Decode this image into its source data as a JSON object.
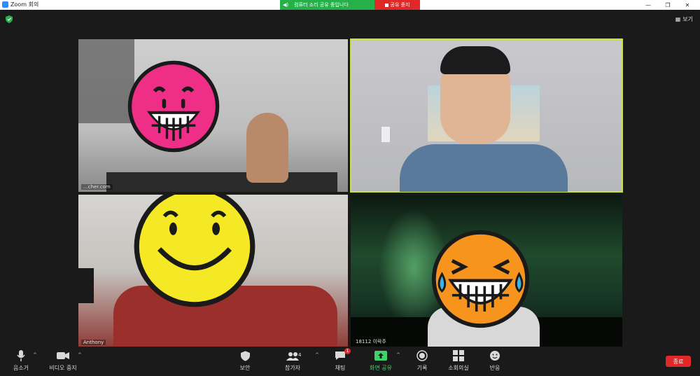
{
  "window": {
    "title": "Zoom 회의"
  },
  "share_banner": {
    "message": "컴퓨터 소리 공유 중입니다",
    "stop_label": "공유 중지"
  },
  "header": {
    "view_label": "보기"
  },
  "tiles": [
    {
      "name": "...cher.com"
    },
    {
      "name": ""
    },
    {
      "name": "Anthony"
    },
    {
      "name": "18112 이락주"
    }
  ],
  "toolbar": {
    "mute_label": "음소거",
    "video_label": "비디오 중지",
    "security_label": "보안",
    "participants_label": "참가자",
    "participants_count": "4",
    "chat_label": "채팅",
    "chat_badge": "1",
    "share_label": "화면 공유",
    "record_label": "기록",
    "breakout_label": "소회의실",
    "reactions_label": "반응",
    "end_label": "종료"
  },
  "colors": {
    "share_green": "#26b04a",
    "end_red": "#e02828",
    "active_speaker": "#c6e43b"
  }
}
